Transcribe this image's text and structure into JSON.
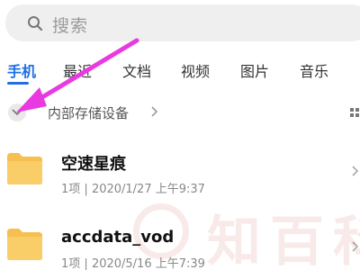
{
  "search": {
    "placeholder": "搜索",
    "icon": "search-icon"
  },
  "tabs": [
    {
      "label": "手机",
      "active": true
    },
    {
      "label": "最近",
      "active": false
    },
    {
      "label": "文档",
      "active": false
    },
    {
      "label": "视频",
      "active": false
    },
    {
      "label": "图片",
      "active": false
    },
    {
      "label": "音乐",
      "active": false
    }
  ],
  "location": {
    "label": "内部存储设备",
    "toggle_icon": "chevron-down-icon",
    "view_icon": "grid-view-icon"
  },
  "files": [
    {
      "name": "空速星痕",
      "count": "1项",
      "date": "2020/1/27 上午9:37"
    },
    {
      "name": "accdata_vod",
      "count": "1项",
      "date": "2020/5/16 上午7:39"
    }
  ],
  "watermark": {
    "text": "知百科"
  },
  "colors": {
    "accent": "#1f6fe5",
    "folder": "#f6bf4f",
    "annotation_arrow": "#e83ae0"
  }
}
